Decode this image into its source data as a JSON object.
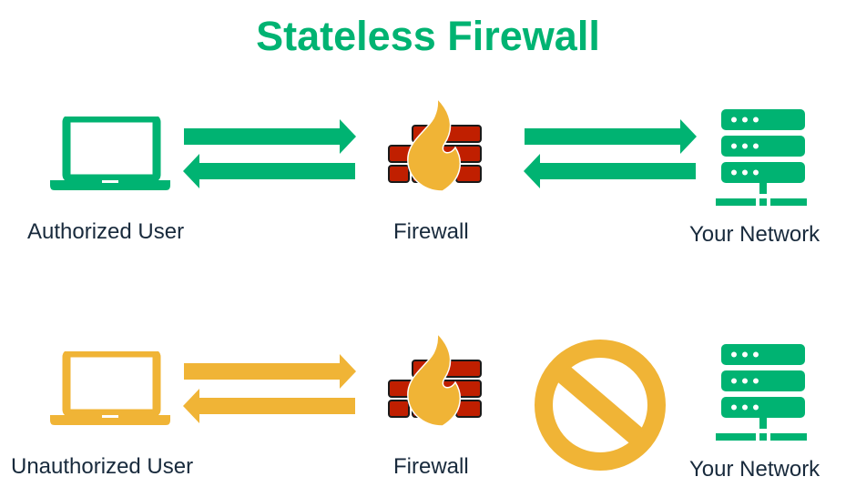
{
  "title": "Stateless Firewall",
  "colors": {
    "allowed": "#00b372",
    "blocked": "#f0b436",
    "brick": "#c01f00",
    "brick_outline": "#1a1a1a",
    "flame": "#f0b436",
    "label_text": "#182a3c"
  },
  "rows": [
    {
      "id": "authorized",
      "user_label": "Authorized User",
      "firewall_label": "Firewall",
      "network_label": "Your Network",
      "user_icon": "laptop-icon",
      "status": "allowed",
      "outcome_icon": null
    },
    {
      "id": "unauthorized",
      "user_label": "Unauthorized User",
      "firewall_label": "Firewall",
      "network_label": "Your Network",
      "user_icon": "laptop-icon",
      "status": "blocked",
      "outcome_icon": "prohibited-icon"
    }
  ]
}
